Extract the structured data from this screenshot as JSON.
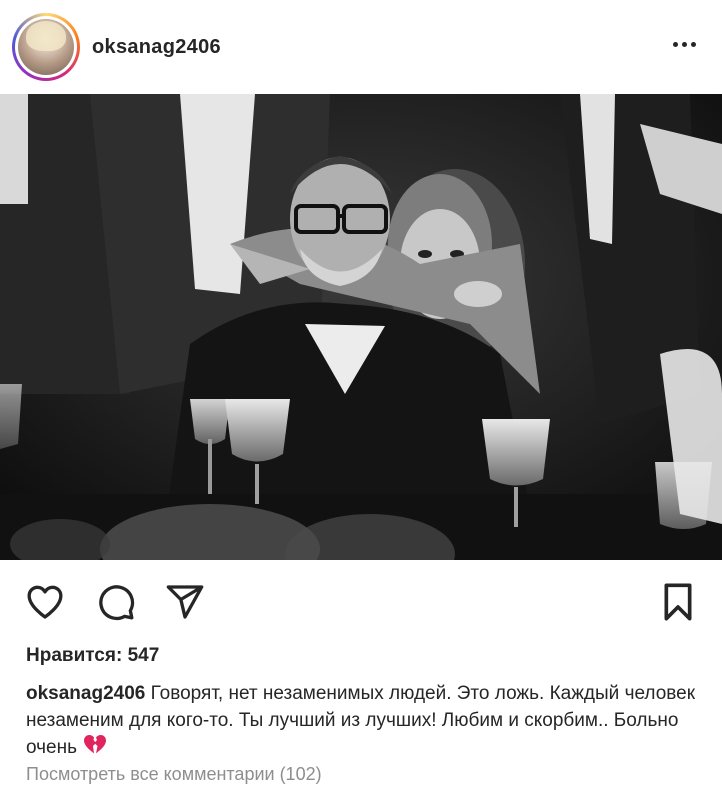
{
  "header": {
    "username": "oksanag2406",
    "avatar": "profile-avatar",
    "more_icon": "more-dots-icon"
  },
  "post": {
    "photo": "black-and-white photo of a man in glasses with a woman embracing him from behind at a dinner table"
  },
  "actions": {
    "like_icon": "heart-icon",
    "comment_icon": "comment-icon",
    "share_icon": "paper-plane-icon",
    "save_icon": "bookmark-icon"
  },
  "likes": {
    "text": "Нравится: 547"
  },
  "caption": {
    "username": "oksanag2406",
    "text": "Говорят,  нет незаменимых людей. Это ложь. Каждый человек незаменим для кого-то. Ты лучший из лучших! Любим и скорбим.. Больно очень",
    "emoji": "broken-heart-icon",
    "heart_color": "#e0245e"
  },
  "comments": {
    "view_all": "Посмотреть все комментарии (102)"
  }
}
